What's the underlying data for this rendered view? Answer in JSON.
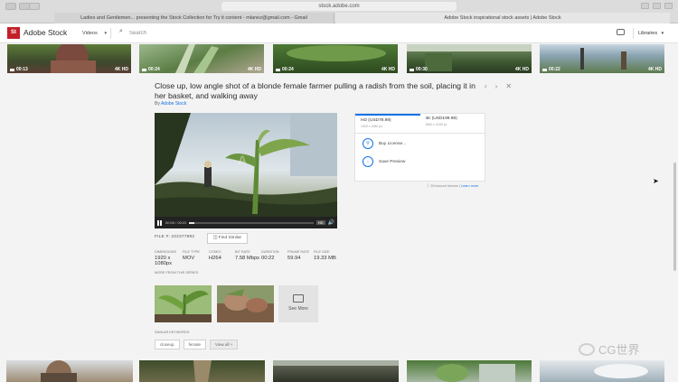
{
  "browser": {
    "url": "stock.adobe.com",
    "tab_left": "Ladies and Gentlemen... presenting the Stock Collection for Try it content - mlanez@gmail.com - Gmail",
    "tab_right": "Adobe Stock inspirational stock assets | Adobe Stock"
  },
  "header": {
    "logo": "St",
    "brand": "Adobe Stock",
    "filter": "Videos",
    "search_placeholder": "Search",
    "libraries": "Libraries"
  },
  "top_thumbs": [
    {
      "duration": "00:13",
      "badges": "4K  HD"
    },
    {
      "duration": "00:24",
      "badges": "4K  HD"
    },
    {
      "duration": "00:24",
      "badges": "4K  HD"
    },
    {
      "duration": "00:30",
      "badges": "4K  HD"
    },
    {
      "duration": "00:22",
      "badges": "4K  HD"
    }
  ],
  "asset": {
    "title": "Close up, low angle shot of a blonde female farmer pulling a radish from the soil, placing it in her basket, and walking away",
    "by": "By",
    "author": "Adobe Stock",
    "timecode": "00:00 / 00:22",
    "progress": 0.04,
    "quality": "HD",
    "file_number": "FILE #: 222377892",
    "find_similar": "Find Similar",
    "specs": [
      {
        "label": "DIMENSIONS",
        "value": "1920 x 1080px"
      },
      {
        "label": "FILE TYPE",
        "value": "MOV"
      },
      {
        "label": "CODEC",
        "value": "H264"
      },
      {
        "label": "BIT RATE",
        "value": "7.58 Mbps"
      },
      {
        "label": "DURATION",
        "value": "00:22"
      },
      {
        "label": "FRAME RATE",
        "value": "59.94"
      },
      {
        "label": "FILE SIZE",
        "value": "19.33 MB"
      }
    ],
    "more_from_series": "MORE FROM THIS SERIES",
    "see_more": "See More",
    "similar_keywords": "SIMILAR KEYWORDS",
    "keywords": [
      "closeup",
      "female",
      "View all +"
    ]
  },
  "license": {
    "tab_hd": "HD (USD79.99)",
    "tab_hd_sub": "1920 x 1080 px",
    "tab_4k": "4K (USD199.99)",
    "tab_4k_sub": "3840 x 2160 px",
    "buy": "Buy License...",
    "save": "Save Preview",
    "enhanced_prefix": "Enhanced license |",
    "learn_more": "Learn more"
  },
  "watermark": "CG世界"
}
